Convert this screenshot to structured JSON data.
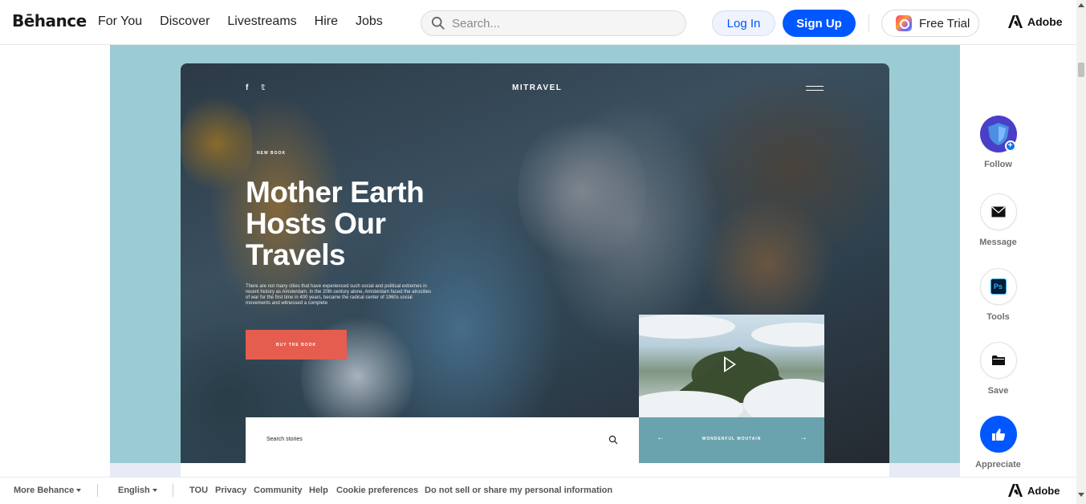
{
  "header": {
    "logo": "Bēhance",
    "nav": [
      "For You",
      "Discover",
      "Livestreams",
      "Hire",
      "Jobs"
    ],
    "search_placeholder": "Search...",
    "login_label": "Log In",
    "signup_label": "Sign Up",
    "trial_label": "Free Trial",
    "adobe_label": "Adobe"
  },
  "project": {
    "social_icons": [
      "f",
      "𝕥"
    ],
    "brand": "MITRAVEL",
    "tag": "NEW BOOK",
    "headline": "Mother Earth Hosts Our Travels",
    "paragraph": "There are not many cities that have experienced such social and political extremes in recent history as Amsterdam. In the 20th century alone, Amsterdam faced the atrocities of war for the first time in 400 years, became the radical center of 1960s social movements and witnessed a complete",
    "buy_label": "BUY THE BOOK",
    "search_stories_label": "Search stories",
    "video_caption": "WONDERFUL MOUTAIN",
    "arrow_left": "←",
    "arrow_right": "→"
  },
  "rail": {
    "follow": "Follow",
    "message": "Message",
    "tools": "Tools",
    "tools_badge": "Ps",
    "save": "Save",
    "appreciate": "Appreciate"
  },
  "footer": {
    "more": "More Behance",
    "language": "English",
    "links": [
      "TOU",
      "Privacy",
      "Community",
      "Help",
      "Cookie preferences",
      "Do not sell or share my personal information"
    ],
    "adobe_label": "Adobe"
  },
  "colors": {
    "accent_blue": "#0057ff",
    "canvas_bg": "#9cccd3",
    "buy_button": "#e55d4f",
    "follow_avatar": "#4b3ec7"
  }
}
